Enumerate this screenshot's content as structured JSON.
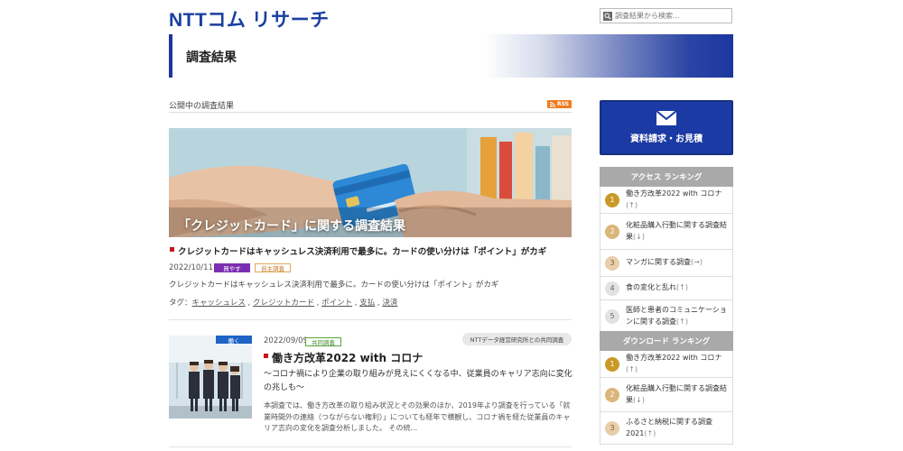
{
  "header": {
    "logo": "NTTコム リサーチ",
    "search_placeholder": "調査結果から検索..."
  },
  "banner": {
    "title": "調査結果"
  },
  "section": {
    "title": "公開中の調査結果",
    "rss": "RSS"
  },
  "featured": {
    "image_caption": "「クレジットカード」に関する調査結果",
    "title": "クレジットカードはキャッシュレス決済利用で最多に。カードの使い分けは「ポイント」がカギ",
    "date": "2022/10/11",
    "badges": [
      "買やす",
      "自主調査"
    ],
    "summary": "クレジットカードはキャッシュレス決済利用で最多に。カードの使い分けは「ポイント」がカギ",
    "tags_label": "タグ：",
    "tags": [
      "キャッシュレス",
      "クレジットカード",
      "ポイント",
      "支払",
      "決済"
    ]
  },
  "article2": {
    "category": "働く",
    "date": "2022/09/09",
    "badge": "共同調査",
    "collab": "NTTデータ経営研究所との共同調査",
    "title": "働き方改革2022 with コロナ",
    "subtitle": "〜コロナ禍により企業の取り組みが見えにくくなる中、従業員のキャリア志向に変化の兆しも〜",
    "body": "本調査では、働き方改革の取り組み状況とその効果のほか、2019年より調査を行っている「就業時間外の連絡（つながらない権利）」についても経年で横観し、コロナ禍を経た従業員のキャリア志向の変化を調査分析しました。 その続..."
  },
  "cta": {
    "label": "資料請求・お見積",
    "icon": "envelope-icon"
  },
  "access_ranking": {
    "title": "アクセス ランキング",
    "items": [
      {
        "rank": "1",
        "text": "働き方改革2022 with コロナ",
        "trend": "(↑)"
      },
      {
        "rank": "2",
        "text": "化粧品購入行動に関する調査結果",
        "trend": "(↓)"
      },
      {
        "rank": "3",
        "text": "マンガに関する調査",
        "trend": "(→)"
      },
      {
        "rank": "4",
        "text": "食の変化と乱れ",
        "trend": "(↑)"
      },
      {
        "rank": "5",
        "text": "医師と患者のコミュニケーションに関する調査",
        "trend": "(↑)"
      }
    ]
  },
  "download_ranking": {
    "title": "ダウンロード ランキング",
    "items": [
      {
        "rank": "1",
        "text": "働き方改革2022 with コロナ",
        "trend": "(↑)"
      },
      {
        "rank": "2",
        "text": "化粧品購入行動に関する調査結果",
        "trend": "(↓)"
      },
      {
        "rank": "3",
        "text": "ふるさと納税に関する調査2021",
        "trend": "(↑)"
      }
    ]
  },
  "colors": {
    "brand_blue": "#1c3aa3",
    "rss_orange": "#f07c22",
    "accent_red": "#c8161e",
    "badge_purple": "#7a2fb0",
    "rank_gold": "#c99a25"
  }
}
